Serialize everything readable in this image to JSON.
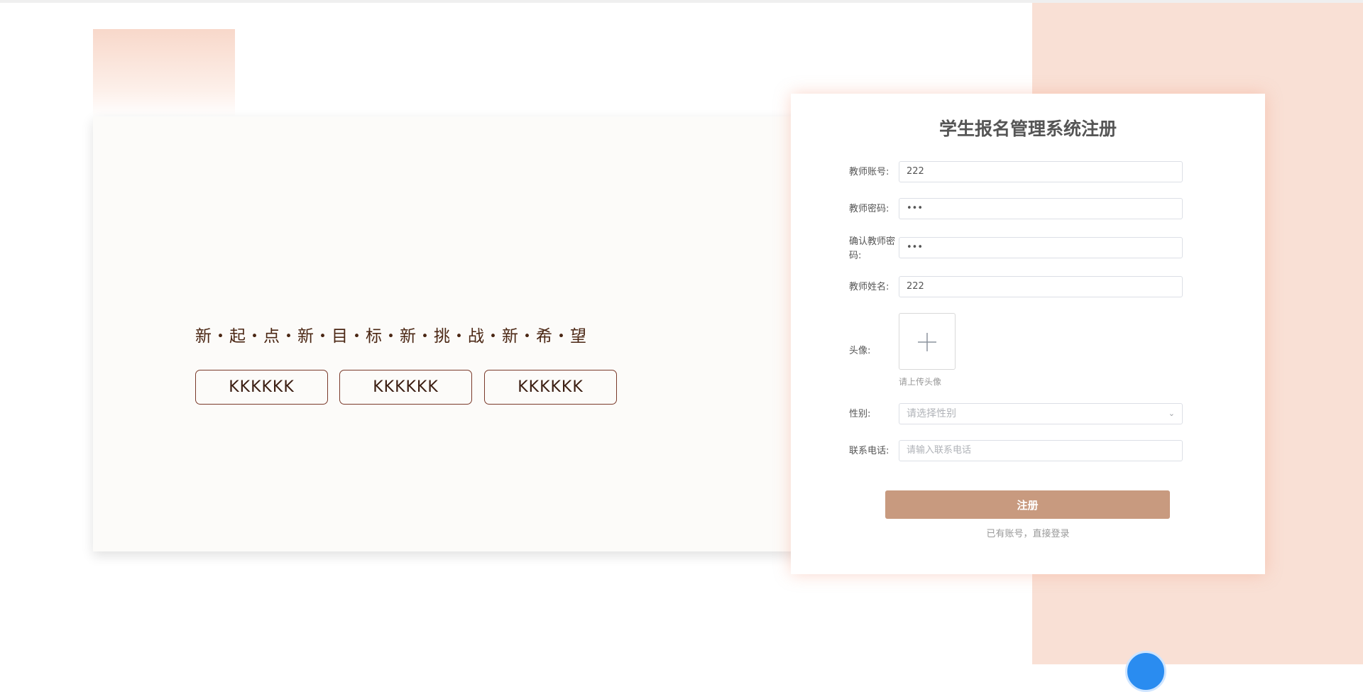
{
  "hero": {
    "slogan": "新・起・点・新・目・标・新・挑・战・新・希・望",
    "buttons": [
      "KKKKKK",
      "KKKKKK",
      "KKKKKK"
    ]
  },
  "form": {
    "title": "学生报名管理系统注册",
    "fields": [
      {
        "label": "教师账号:",
        "value": "222"
      },
      {
        "label": "教师密码:",
        "value": "•••"
      },
      {
        "label": "确认教师密码:",
        "value": "•••"
      },
      {
        "label": "教师姓名:",
        "value": "222"
      }
    ],
    "avatar": {
      "label": "头像:",
      "hint": "请上传头像",
      "icon": "plus-icon"
    },
    "gender": {
      "label": "性别:",
      "placeholder": "请选择性别"
    },
    "phone": {
      "label": "联系电话:",
      "placeholder": "请输入联系电话"
    },
    "submit_label": "注册",
    "login_link": "已有账号，直接登录"
  },
  "colors": {
    "accent": "#c89a7f",
    "right_background": "#f9e0d5",
    "text_brown": "#4a2613"
  }
}
